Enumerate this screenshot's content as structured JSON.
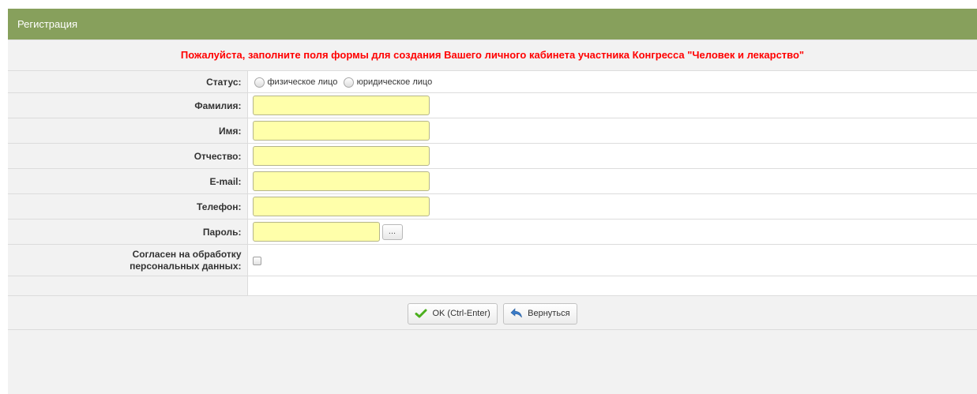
{
  "header": {
    "title": "Регистрация"
  },
  "notice": "Пожалуйста, заполните поля формы для создания Вашего личного кабинета участника Конгресса \"Человек и лекарство\"",
  "status": {
    "label": "Статус:",
    "options": [
      "физическое лицо",
      "юридическое лицо"
    ]
  },
  "fields": {
    "last_name": {
      "label": "Фамилия:",
      "value": ""
    },
    "first_name": {
      "label": "Имя:",
      "value": ""
    },
    "patronymic": {
      "label": "Отчество:",
      "value": ""
    },
    "email": {
      "label": "E-mail:",
      "value": ""
    },
    "phone": {
      "label": "Телефон:",
      "value": ""
    },
    "password": {
      "label": "Пароль:",
      "value": "",
      "button_label": "..."
    }
  },
  "consent": {
    "label_line1": "Согласен на обработку",
    "label_line2": "персональных данных:"
  },
  "actions": {
    "ok_label": "OK (Ctrl-Enter)",
    "back_label": "Вернуться"
  },
  "colors": {
    "header_bg": "#87a05c",
    "notice_text": "#ff0000",
    "input_bg": "#ffffaa",
    "ok_icon": "#4caf1e",
    "back_icon": "#3a7bc8"
  },
  "icons": {
    "ok": "check-icon",
    "back": "undo-arrow-icon"
  }
}
